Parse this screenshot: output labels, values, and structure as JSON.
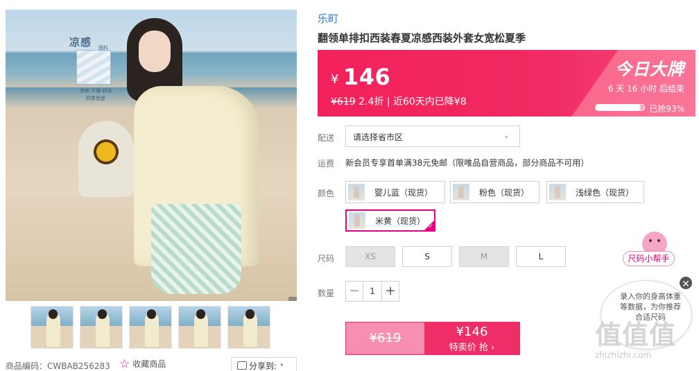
{
  "gallery": {
    "main_badge": {
      "title": "凉感",
      "logo_text": "面料",
      "caption_line1": "凉爽 干燥 舒适",
      "caption_line2": "四季皆宜"
    },
    "thumbnail_count": 5
  },
  "footer": {
    "item_code_label": "商品编码：CWBAB256283",
    "favorite_label": "收藏商品",
    "share_label": "分享到:"
  },
  "product": {
    "brand": "乐町",
    "title": "翻领单排扣西装春夏凉感西装外套女宽松夏季"
  },
  "price_banner": {
    "currency": "¥",
    "price": "146",
    "original_price": "¥619",
    "sub_text": " 2.4折 | 近60天内已降¥8",
    "deal_title": "今日大牌",
    "countdown": "6 天 16 小时 后结束",
    "grabbed_percent": 93,
    "grabbed_label": "已抢93%",
    "accent_color": "#f3215b"
  },
  "delivery": {
    "label": "配送",
    "region_placeholder": "请选择省市区"
  },
  "shipping": {
    "label": "运费",
    "text": "新会员专享首单满38元免邮（限唯品自营商品，部分商品不可用）"
  },
  "colors": {
    "label": "颜色",
    "options": [
      {
        "label": "婴儿蓝（现货）",
        "selected": false
      },
      {
        "label": "粉色（现货）",
        "selected": false
      },
      {
        "label": "浅绿色（现货）",
        "selected": false
      },
      {
        "label": "米黄（现货）",
        "selected": true
      }
    ]
  },
  "sizes": {
    "label": "尺码",
    "options": [
      {
        "label": "XS",
        "available": false
      },
      {
        "label": "S",
        "available": true
      },
      {
        "label": "M",
        "available": false
      },
      {
        "label": "L",
        "available": true
      }
    ]
  },
  "quantity": {
    "label": "数量",
    "value": "1",
    "minus": "−",
    "plus": "+"
  },
  "buy": {
    "original_price": "¥619",
    "special_price": "¥146",
    "special_label": "特卖价 抢 ›"
  },
  "size_helper": {
    "label": "尺码小帮手",
    "text": "录入你的身高体重等数据，为你推荐合适尺码",
    "close": "✕"
  },
  "watermark": {
    "logo": "值值值",
    "url": "zhizhizhi.com"
  }
}
